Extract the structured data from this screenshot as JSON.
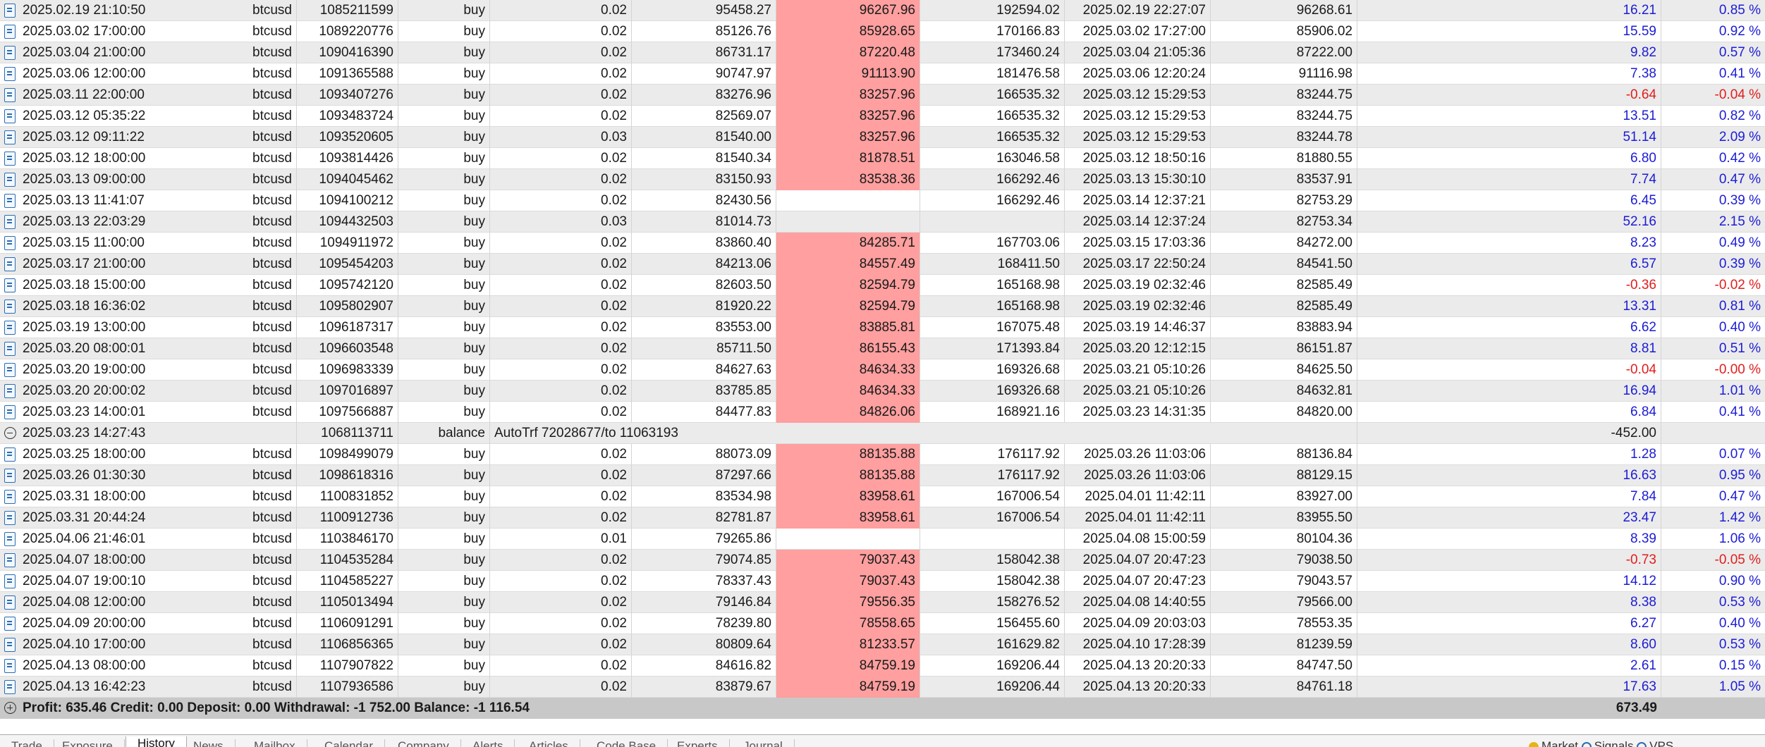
{
  "rows": [
    {
      "kind": "trade",
      "time": "2025.02.19 21:10:50",
      "symbol": "btcusd",
      "ticket": "1085211599",
      "type": "buy",
      "volume": "0.02",
      "open": "95458.27",
      "sl": "96267.96",
      "tp": "192594.02",
      "close_time": "2025.02.19 22:27:07",
      "close_price": "96268.61",
      "profit": "16.21",
      "pct": "0.85 %",
      "sign": "pos"
    },
    {
      "kind": "trade",
      "time": "2025.03.02 17:00:00",
      "symbol": "btcusd",
      "ticket": "1089220776",
      "type": "buy",
      "volume": "0.02",
      "open": "85126.76",
      "sl": "85928.65",
      "tp": "170166.83",
      "close_time": "2025.03.02 17:27:00",
      "close_price": "85906.02",
      "profit": "15.59",
      "pct": "0.92 %",
      "sign": "pos"
    },
    {
      "kind": "trade",
      "time": "2025.03.04 21:00:00",
      "symbol": "btcusd",
      "ticket": "1090416390",
      "type": "buy",
      "volume": "0.02",
      "open": "86731.17",
      "sl": "87220.48",
      "tp": "173460.24",
      "close_time": "2025.03.04 21:05:36",
      "close_price": "87222.00",
      "profit": "9.82",
      "pct": "0.57 %",
      "sign": "pos"
    },
    {
      "kind": "trade",
      "time": "2025.03.06 12:00:00",
      "symbol": "btcusd",
      "ticket": "1091365588",
      "type": "buy",
      "volume": "0.02",
      "open": "90747.97",
      "sl": "91113.90",
      "tp": "181476.58",
      "close_time": "2025.03.06 12:20:24",
      "close_price": "91116.98",
      "profit": "7.38",
      "pct": "0.41 %",
      "sign": "pos"
    },
    {
      "kind": "trade",
      "time": "2025.03.11 22:00:00",
      "symbol": "btcusd",
      "ticket": "1093407276",
      "type": "buy",
      "volume": "0.02",
      "open": "83276.96",
      "sl": "83257.96",
      "tp": "166535.32",
      "close_time": "2025.03.12 15:29:53",
      "close_price": "83244.75",
      "profit": "-0.64",
      "pct": "-0.04 %",
      "sign": "neg"
    },
    {
      "kind": "trade",
      "time": "2025.03.12 05:35:22",
      "symbol": "btcusd",
      "ticket": "1093483724",
      "type": "buy",
      "volume": "0.02",
      "open": "82569.07",
      "sl": "83257.96",
      "tp": "166535.32",
      "close_time": "2025.03.12 15:29:53",
      "close_price": "83244.75",
      "profit": "13.51",
      "pct": "0.82 %",
      "sign": "pos"
    },
    {
      "kind": "trade",
      "time": "2025.03.12 09:11:22",
      "symbol": "btcusd",
      "ticket": "1093520605",
      "type": "buy",
      "volume": "0.03",
      "open": "81540.00",
      "sl": "83257.96",
      "tp": "166535.32",
      "close_time": "2025.03.12 15:29:53",
      "close_price": "83244.78",
      "profit": "51.14",
      "pct": "2.09 %",
      "sign": "pos"
    },
    {
      "kind": "trade",
      "time": "2025.03.12 18:00:00",
      "symbol": "btcusd",
      "ticket": "1093814426",
      "type": "buy",
      "volume": "0.02",
      "open": "81540.34",
      "sl": "81878.51",
      "tp": "163046.58",
      "close_time": "2025.03.12 18:50:16",
      "close_price": "81880.55",
      "profit": "6.80",
      "pct": "0.42 %",
      "sign": "pos"
    },
    {
      "kind": "trade",
      "time": "2025.03.13 09:00:00",
      "symbol": "btcusd",
      "ticket": "1094045462",
      "type": "buy",
      "volume": "0.02",
      "open": "83150.93",
      "sl": "83538.36",
      "tp": "166292.46",
      "close_time": "2025.03.13 15:30:10",
      "close_price": "83537.91",
      "profit": "7.74",
      "pct": "0.47 %",
      "sign": "pos"
    },
    {
      "kind": "trade",
      "time": "2025.03.13 11:41:07",
      "symbol": "btcusd",
      "ticket": "1094100212",
      "type": "buy",
      "volume": "0.02",
      "open": "82430.56",
      "sl": "",
      "tp": "166292.46",
      "close_time": "2025.03.14 12:37:21",
      "close_price": "82753.29",
      "profit": "6.45",
      "pct": "0.39 %",
      "sign": "pos"
    },
    {
      "kind": "trade",
      "time": "2025.03.13 22:03:29",
      "symbol": "btcusd",
      "ticket": "1094432503",
      "type": "buy",
      "volume": "0.03",
      "open": "81014.73",
      "sl": "",
      "tp": "",
      "close_time": "2025.03.14 12:37:24",
      "close_price": "82753.34",
      "profit": "52.16",
      "pct": "2.15 %",
      "sign": "pos"
    },
    {
      "kind": "trade",
      "time": "2025.03.15 11:00:00",
      "symbol": "btcusd",
      "ticket": "1094911972",
      "type": "buy",
      "volume": "0.02",
      "open": "83860.40",
      "sl": "84285.71",
      "tp": "167703.06",
      "close_time": "2025.03.15 17:03:36",
      "close_price": "84272.00",
      "profit": "8.23",
      "pct": "0.49 %",
      "sign": "pos"
    },
    {
      "kind": "trade",
      "time": "2025.03.17 21:00:00",
      "symbol": "btcusd",
      "ticket": "1095454203",
      "type": "buy",
      "volume": "0.02",
      "open": "84213.06",
      "sl": "84557.49",
      "tp": "168411.50",
      "close_time": "2025.03.17 22:50:24",
      "close_price": "84541.50",
      "profit": "6.57",
      "pct": "0.39 %",
      "sign": "pos"
    },
    {
      "kind": "trade",
      "time": "2025.03.18 15:00:00",
      "symbol": "btcusd",
      "ticket": "1095742120",
      "type": "buy",
      "volume": "0.02",
      "open": "82603.50",
      "sl": "82594.79",
      "tp": "165168.98",
      "close_time": "2025.03.19 02:32:46",
      "close_price": "82585.49",
      "profit": "-0.36",
      "pct": "-0.02 %",
      "sign": "neg"
    },
    {
      "kind": "trade",
      "time": "2025.03.18 16:36:02",
      "symbol": "btcusd",
      "ticket": "1095802907",
      "type": "buy",
      "volume": "0.02",
      "open": "81920.22",
      "sl": "82594.79",
      "tp": "165168.98",
      "close_time": "2025.03.19 02:32:46",
      "close_price": "82585.49",
      "profit": "13.31",
      "pct": "0.81 %",
      "sign": "pos"
    },
    {
      "kind": "trade",
      "time": "2025.03.19 13:00:00",
      "symbol": "btcusd",
      "ticket": "1096187317",
      "type": "buy",
      "volume": "0.02",
      "open": "83553.00",
      "sl": "83885.81",
      "tp": "167075.48",
      "close_time": "2025.03.19 14:46:37",
      "close_price": "83883.94",
      "profit": "6.62",
      "pct": "0.40 %",
      "sign": "pos"
    },
    {
      "kind": "trade",
      "time": "2025.03.20 08:00:01",
      "symbol": "btcusd",
      "ticket": "1096603548",
      "type": "buy",
      "volume": "0.02",
      "open": "85711.50",
      "sl": "86155.43",
      "tp": "171393.84",
      "close_time": "2025.03.20 12:12:15",
      "close_price": "86151.87",
      "profit": "8.81",
      "pct": "0.51 %",
      "sign": "pos"
    },
    {
      "kind": "trade",
      "time": "2025.03.20 19:00:00",
      "symbol": "btcusd",
      "ticket": "1096983339",
      "type": "buy",
      "volume": "0.02",
      "open": "84627.63",
      "sl": "84634.33",
      "tp": "169326.68",
      "close_time": "2025.03.21 05:10:26",
      "close_price": "84625.50",
      "profit": "-0.04",
      "pct": "-0.00 %",
      "sign": "neg"
    },
    {
      "kind": "trade",
      "time": "2025.03.20 20:00:02",
      "symbol": "btcusd",
      "ticket": "1097016897",
      "type": "buy",
      "volume": "0.02",
      "open": "83785.85",
      "sl": "84634.33",
      "tp": "169326.68",
      "close_time": "2025.03.21 05:10:26",
      "close_price": "84632.81",
      "profit": "16.94",
      "pct": "1.01 %",
      "sign": "pos"
    },
    {
      "kind": "trade",
      "time": "2025.03.23 14:00:01",
      "symbol": "btcusd",
      "ticket": "1097566887",
      "type": "buy",
      "volume": "0.02",
      "open": "84477.83",
      "sl": "84826.06",
      "tp": "168921.16",
      "close_time": "2025.03.23 14:31:35",
      "close_price": "84820.00",
      "profit": "6.84",
      "pct": "0.41 %",
      "sign": "pos"
    },
    {
      "kind": "balance",
      "time": "2025.03.23 14:27:43",
      "ticket": "1068113711",
      "type": "balance",
      "comment": "AutoTrf 72028677/to 11063193",
      "profit": "-452.00"
    },
    {
      "kind": "trade",
      "time": "2025.03.25 18:00:00",
      "symbol": "btcusd",
      "ticket": "1098499079",
      "type": "buy",
      "volume": "0.02",
      "open": "88073.09",
      "sl": "88135.88",
      "tp": "176117.92",
      "close_time": "2025.03.26 11:03:06",
      "close_price": "88136.84",
      "profit": "1.28",
      "pct": "0.07 %",
      "sign": "pos"
    },
    {
      "kind": "trade",
      "time": "2025.03.26 01:30:30",
      "symbol": "btcusd",
      "ticket": "1098618316",
      "type": "buy",
      "volume": "0.02",
      "open": "87297.66",
      "sl": "88135.88",
      "tp": "176117.92",
      "close_time": "2025.03.26 11:03:06",
      "close_price": "88129.15",
      "profit": "16.63",
      "pct": "0.95 %",
      "sign": "pos"
    },
    {
      "kind": "trade",
      "time": "2025.03.31 18:00:00",
      "symbol": "btcusd",
      "ticket": "1100831852",
      "type": "buy",
      "volume": "0.02",
      "open": "83534.98",
      "sl": "83958.61",
      "tp": "167006.54",
      "close_time": "2025.04.01 11:42:11",
      "close_price": "83927.00",
      "profit": "7.84",
      "pct": "0.47 %",
      "sign": "pos"
    },
    {
      "kind": "trade",
      "time": "2025.03.31 20:44:24",
      "symbol": "btcusd",
      "ticket": "1100912736",
      "type": "buy",
      "volume": "0.02",
      "open": "82781.87",
      "sl": "83958.61",
      "tp": "167006.54",
      "close_time": "2025.04.01 11:42:11",
      "close_price": "83955.50",
      "profit": "23.47",
      "pct": "1.42 %",
      "sign": "pos"
    },
    {
      "kind": "trade",
      "time": "2025.04.06 21:46:01",
      "symbol": "btcusd",
      "ticket": "1103846170",
      "type": "buy",
      "volume": "0.01",
      "open": "79265.86",
      "sl": "",
      "tp": "",
      "close_time": "2025.04.08 15:00:59",
      "close_price": "80104.36",
      "profit": "8.39",
      "pct": "1.06 %",
      "sign": "pos"
    },
    {
      "kind": "trade",
      "time": "2025.04.07 18:00:00",
      "symbol": "btcusd",
      "ticket": "1104535284",
      "type": "buy",
      "volume": "0.02",
      "open": "79074.85",
      "sl": "79037.43",
      "tp": "158042.38",
      "close_time": "2025.04.07 20:47:23",
      "close_price": "79038.50",
      "profit": "-0.73",
      "pct": "-0.05 %",
      "sign": "neg"
    },
    {
      "kind": "trade",
      "time": "2025.04.07 19:00:10",
      "symbol": "btcusd",
      "ticket": "1104585227",
      "type": "buy",
      "volume": "0.02",
      "open": "78337.43",
      "sl": "79037.43",
      "tp": "158042.38",
      "close_time": "2025.04.07 20:47:23",
      "close_price": "79043.57",
      "profit": "14.12",
      "pct": "0.90 %",
      "sign": "pos"
    },
    {
      "kind": "trade",
      "time": "2025.04.08 12:00:00",
      "symbol": "btcusd",
      "ticket": "1105013494",
      "type": "buy",
      "volume": "0.02",
      "open": "79146.84",
      "sl": "79556.35",
      "tp": "158276.52",
      "close_time": "2025.04.08 14:40:55",
      "close_price": "79566.00",
      "profit": "8.38",
      "pct": "0.53 %",
      "sign": "pos"
    },
    {
      "kind": "trade",
      "time": "2025.04.09 20:00:00",
      "symbol": "btcusd",
      "ticket": "1106091291",
      "type": "buy",
      "volume": "0.02",
      "open": "78239.80",
      "sl": "78558.65",
      "tp": "156455.60",
      "close_time": "2025.04.09 20:03:03",
      "close_price": "78553.35",
      "profit": "6.27",
      "pct": "0.40 %",
      "sign": "pos"
    },
    {
      "kind": "trade",
      "time": "2025.04.10 17:00:00",
      "symbol": "btcusd",
      "ticket": "1106856365",
      "type": "buy",
      "volume": "0.02",
      "open": "80809.64",
      "sl": "81233.57",
      "tp": "161629.82",
      "close_time": "2025.04.10 17:28:39",
      "close_price": "81239.59",
      "profit": "8.60",
      "pct": "0.53 %",
      "sign": "pos"
    },
    {
      "kind": "trade",
      "time": "2025.04.13 08:00:00",
      "symbol": "btcusd",
      "ticket": "1107907822",
      "type": "buy",
      "volume": "0.02",
      "open": "84616.82",
      "sl": "84759.19",
      "tp": "169206.44",
      "close_time": "2025.04.13 20:20:33",
      "close_price": "84747.50",
      "profit": "2.61",
      "pct": "0.15 %",
      "sign": "pos"
    },
    {
      "kind": "trade",
      "time": "2025.04.13 16:42:23",
      "symbol": "btcusd",
      "ticket": "1107936586",
      "type": "buy",
      "volume": "0.02",
      "open": "83879.67",
      "sl": "84759.19",
      "tp": "169206.44",
      "close_time": "2025.04.13 20:20:33",
      "close_price": "84761.18",
      "profit": "17.63",
      "pct": "1.05 %",
      "sign": "pos"
    }
  ],
  "summary": {
    "text": "Profit: 635.46  Credit: 0.00  Deposit: 0.00  Withdrawal: -1 752.00  Balance: -1 116.54",
    "total": "673.49"
  },
  "tabs": [
    "Trade",
    "Exposure",
    "History",
    "News",
    "Mailbox",
    "Calendar",
    "Company",
    "Alerts",
    "Articles",
    "Code Base",
    "Experts",
    "Journal"
  ],
  "active_tab": "History",
  "tabs_right": {
    "market": "Market",
    "signals": "Signals",
    "vps": "VPS"
  },
  "colors": {
    "sl_highlight": "#ff9f9f",
    "positive": "#1c1cd6",
    "negative": "#e11d1d",
    "summary_bg": "#c8c8c8"
  }
}
